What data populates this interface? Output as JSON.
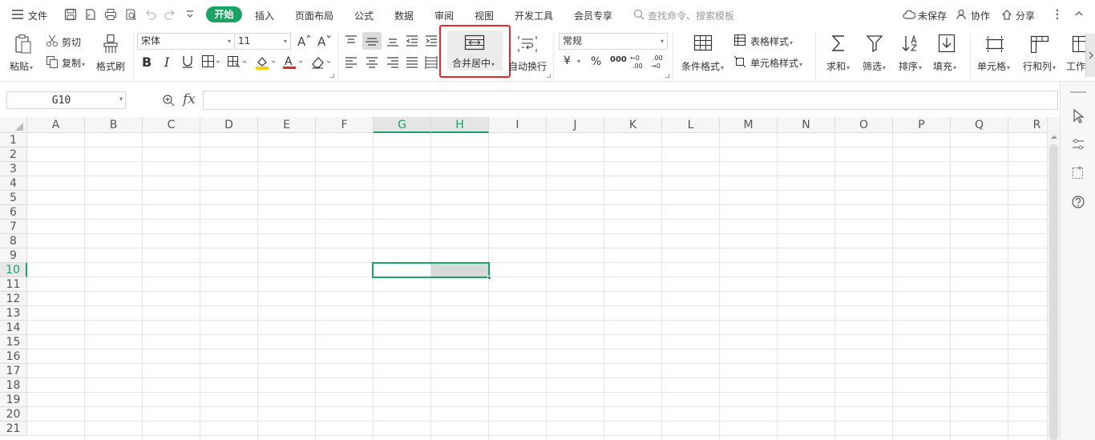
{
  "menubar": {
    "file_label": "文件",
    "tabs": [
      "开始",
      "插入",
      "页面布局",
      "公式",
      "数据",
      "审阅",
      "视图",
      "开发工具",
      "会员专享"
    ],
    "active_tab": "开始",
    "search_placeholder": "查找命令、搜索模板",
    "unsaved_label": "未保存",
    "collab_label": "协作",
    "share_label": "分享"
  },
  "ribbon": {
    "paste": "粘贴",
    "cut": "剪切",
    "copy": "复制",
    "format_painter": "格式刷",
    "font_name": "宋体",
    "font_size": "11",
    "wrap_text": "自动换行",
    "merge_center": "合并居中",
    "number_format": "常规",
    "currency_symbol": "¥",
    "percent_symbol": "%",
    "thousands_symbol": "000",
    "conditional_format": "条件格式",
    "table_style": "表格样式",
    "cell_style": "单元格样式",
    "sum": "求和",
    "filter": "筛选",
    "sort": "排序",
    "fill": "填充",
    "cell": "单元格",
    "row_col": "行和列",
    "worksheet": "工作"
  },
  "formula_bar": {
    "name_box": "G10",
    "fx": "fx",
    "formula": ""
  },
  "sheet": {
    "columns": [
      "A",
      "B",
      "C",
      "D",
      "E",
      "F",
      "G",
      "H",
      "I",
      "J",
      "K",
      "L",
      "M",
      "N",
      "O",
      "P",
      "Q",
      "R"
    ],
    "rows": [
      "1",
      "2",
      "3",
      "4",
      "5",
      "6",
      "7",
      "8",
      "9",
      "10",
      "11",
      "12",
      "13",
      "14",
      "15",
      "16",
      "17",
      "18",
      "19",
      "20",
      "21"
    ],
    "selected_columns": [
      "G",
      "H"
    ],
    "selected_row": "10",
    "selected_range": "G10:H10"
  },
  "colors": {
    "accent": "#1aa363",
    "highlight_box": "#e8272a"
  }
}
